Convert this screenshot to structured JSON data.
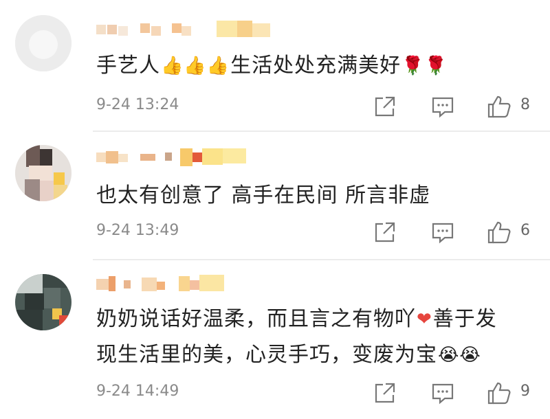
{
  "comments": [
    {
      "username": "",
      "text_parts": [
        "手艺人",
        "👍👍👍",
        "生活处处充满美好",
        "🌹🌹"
      ],
      "time": "9-24 13:24",
      "likes": "8"
    },
    {
      "username": "",
      "text": "也太有创意了 高手在民间 所言非虚",
      "time": "9-24 13:49",
      "likes": "6"
    },
    {
      "username": "",
      "text_line1_a": "奶奶说话好温柔，而且言之有物吖",
      "text_line1_heart": "❤",
      "text_line1_b": "善于发",
      "text_line2": "现生活里的美，心灵手巧，变废为宝",
      "text_line2_emoji": "😭😭",
      "time": "9-24 14:49",
      "likes": "9"
    }
  ],
  "icons": {
    "share": "share-icon",
    "comment": "comment-icon",
    "like": "thumbs-up-icon"
  },
  "colors": {
    "text": "#222222",
    "meta": "#8a8a8a",
    "divider": "#ececec",
    "heart": "#e6453e"
  }
}
